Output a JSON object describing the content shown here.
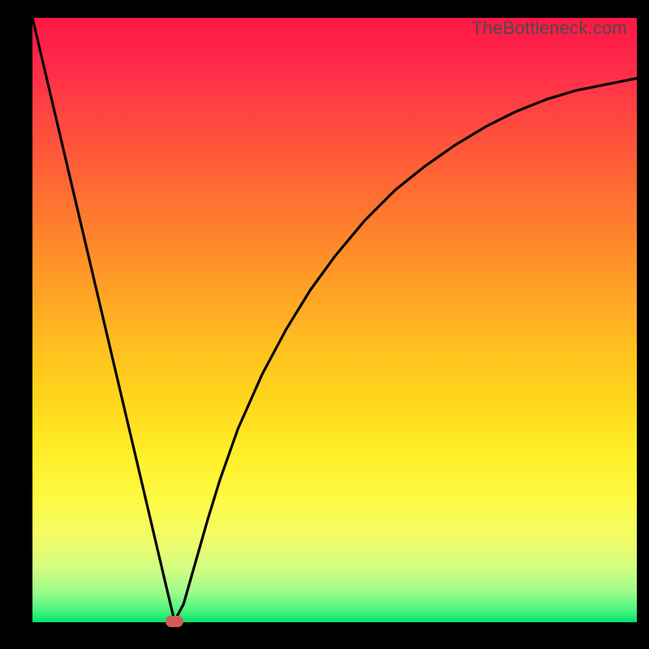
{
  "watermark": "TheBottleneck.com",
  "colors": {
    "frame": "#000000",
    "gradient_top": "#ff1744",
    "gradient_bottom": "#00e36a",
    "curve": "#000000",
    "marker": "#d35b56",
    "watermark": "#4b4b4b"
  },
  "chart_data": {
    "type": "line",
    "title": "",
    "xlabel": "",
    "ylabel": "",
    "xlim": [
      0,
      100
    ],
    "ylim": [
      0,
      100
    ],
    "grid": false,
    "legend": false,
    "series": [
      {
        "name": "bottleneck-curve",
        "x": [
          0,
          2,
          4,
          6,
          8,
          10,
          12,
          14,
          16,
          18,
          20,
          22,
          23.5,
          25,
          27,
          29,
          31,
          34,
          38,
          42,
          46,
          50,
          55,
          60,
          65,
          70,
          75,
          80,
          85,
          90,
          95,
          100
        ],
        "y": [
          100,
          91.5,
          83,
          74.5,
          66,
          57.5,
          49,
          40.5,
          32,
          23.5,
          15,
          6.5,
          0.2,
          3,
          10,
          17,
          23.5,
          32,
          41,
          48.5,
          55,
          60.5,
          66.5,
          71.5,
          75.5,
          79,
          82,
          84.5,
          86.5,
          88,
          89,
          90
        ]
      }
    ],
    "marker": {
      "x": 23.5,
      "y": 0.2
    },
    "annotations": []
  }
}
